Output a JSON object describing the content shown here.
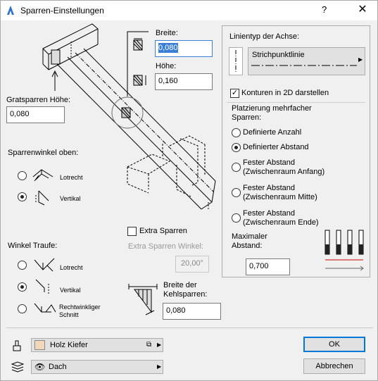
{
  "window": {
    "title": "Sparren-Einstellungen",
    "help_glyph": "?",
    "close_glyph": "✕"
  },
  "top": {
    "breite_label": "Breite:",
    "breite_value": "0,080",
    "hoehe_label": "Höhe:",
    "hoehe_value": "0,160",
    "gratsparren_label": "Gratsparren Höhe:",
    "gratsparren_value": "0,080"
  },
  "sparrenwinkel": {
    "label": "Sparrenwinkel oben:",
    "options": [
      {
        "label": "Lotrecht",
        "selected": false
      },
      {
        "label": "Vertikal",
        "selected": true
      }
    ]
  },
  "extra": {
    "checkbox_label": "Extra Sparren",
    "checked": false,
    "winkel_label": "Extra Sparren Winkel:",
    "winkel_value": "20,00°"
  },
  "traufe": {
    "label": "Winkel Traufe:",
    "options": [
      {
        "label": "Lotrecht",
        "selected": false
      },
      {
        "label": "Vertikal",
        "selected": true
      },
      {
        "label": "Rechtwinkliger",
        "label2": "Schnitt",
        "selected": false
      }
    ]
  },
  "kehl": {
    "label1": "Breite der",
    "label2": "Kehlsparren:",
    "value": "0,080"
  },
  "panel": {
    "linetype_label": "Linientyp der Achse:",
    "linetype_value": "Strichpunktlinie",
    "konturen_label": "Konturen in 2D darstellen",
    "konturen_checked": true,
    "placement_label1": "Platzierung mehrfacher",
    "placement_label2": "Sparren:",
    "options": [
      {
        "label": "Definierte Anzahl",
        "label2": "",
        "selected": false
      },
      {
        "label": "Definierter Abstand",
        "label2": "",
        "selected": true
      },
      {
        "label": "Fester Abstand",
        "label2": "(Zwischenraum Anfang)",
        "selected": false
      },
      {
        "label": "Fester Abstand",
        "label2": "(Zwischenraum Mitte)",
        "selected": false
      },
      {
        "label": "Fester Abstand",
        "label2": "(Zwischenraum Ende)",
        "selected": false
      }
    ],
    "max_label1": "Maximaler",
    "max_label2": "Abstand:",
    "max_value": "0,700"
  },
  "bottom": {
    "material": "Holz Kiefer",
    "material_color": "#f2d7bb",
    "layer": "Dach",
    "ok": "OK",
    "cancel": "Abbrechen"
  }
}
